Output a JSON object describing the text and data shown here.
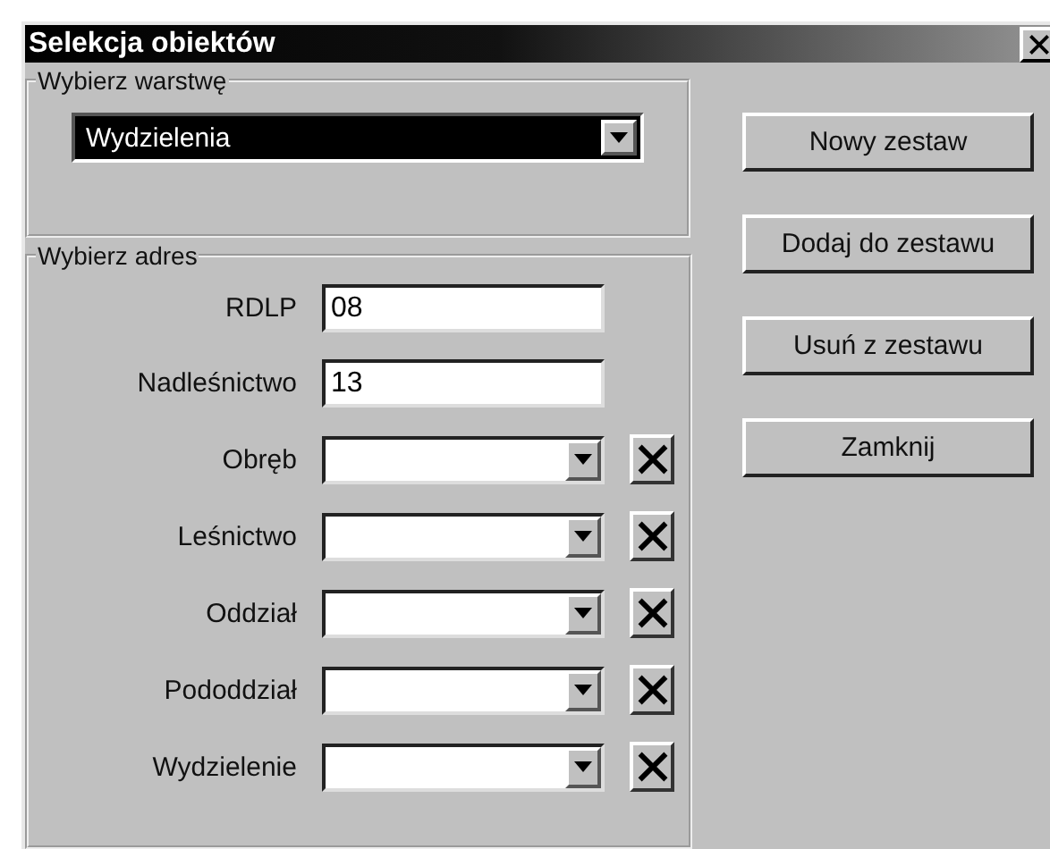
{
  "window": {
    "title": "Selekcja obiektów"
  },
  "layer_group": {
    "title": "Wybierz warstwę",
    "combo": {
      "value": "Wydzielenia",
      "highlighted": true
    }
  },
  "address_group": {
    "title": "Wybierz adres",
    "fields": [
      {
        "kind": "text",
        "label": "RDLP",
        "value": "08"
      },
      {
        "kind": "text",
        "label": "Nadleśnictwo",
        "value": "13"
      },
      {
        "kind": "combo",
        "label": "Obręb"
      },
      {
        "kind": "combo",
        "label": "Leśnictwo"
      },
      {
        "kind": "combo",
        "label": "Oddział"
      },
      {
        "kind": "combo",
        "label": "Pododdział"
      },
      {
        "kind": "combo",
        "label": "Wydzielenie"
      }
    ]
  },
  "buttons": [
    "Nowy zestaw",
    "Dodaj do zestawu",
    "Usuń z zestawu",
    "Zamknij"
  ]
}
